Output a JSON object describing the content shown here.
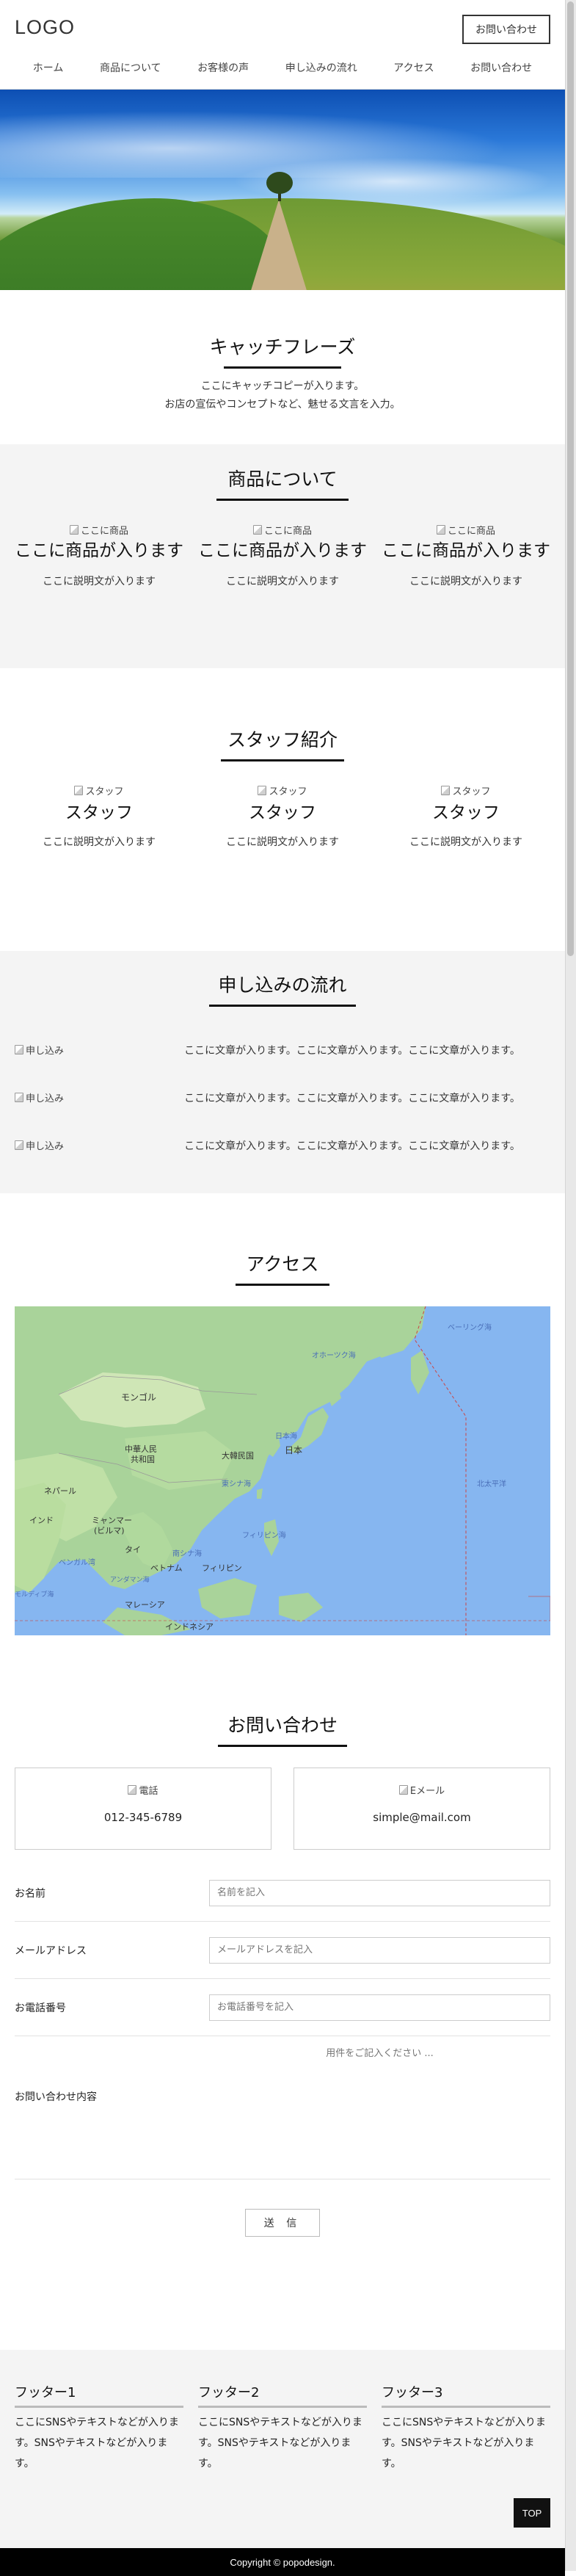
{
  "header": {
    "logo": "LOGO",
    "contact_button": "お問い合わせ",
    "nav": [
      "ホーム",
      "商品について",
      "お客様の声",
      "申し込みの流れ",
      "アクセス",
      "お問い合わせ"
    ]
  },
  "catch": {
    "title": "キャッチフレーズ",
    "line1": "ここにキャッチコピーが入ります。",
    "line2": "お店の宣伝やコンセプトなど、魅せる文言を入力。"
  },
  "products": {
    "title": "商品について",
    "items": [
      {
        "img_alt": "ここに商品",
        "name": "ここに商品が入ります",
        "desc": "ここに説明文が入ります"
      },
      {
        "img_alt": "ここに商品",
        "name": "ここに商品が入ります",
        "desc": "ここに説明文が入ります"
      },
      {
        "img_alt": "ここに商品",
        "name": "ここに商品が入ります",
        "desc": "ここに説明文が入ります"
      }
    ]
  },
  "staff": {
    "title": "スタッフ紹介",
    "items": [
      {
        "img_alt": "スタッフ",
        "name": "スタッフ",
        "desc": "ここに説明文が入ります"
      },
      {
        "img_alt": "スタッフ",
        "name": "スタッフ",
        "desc": "ここに説明文が入ります"
      },
      {
        "img_alt": "スタッフ",
        "name": "スタッフ",
        "desc": "ここに説明文が入ります"
      }
    ]
  },
  "flow": {
    "title": "申し込みの流れ",
    "items": [
      {
        "img_alt": "申し込み",
        "text": "ここに文章が入ります。ここに文章が入ります。ここに文章が入ります。"
      },
      {
        "img_alt": "申し込み",
        "text": "ここに文章が入ります。ここに文章が入ります。ここに文章が入ります。"
      },
      {
        "img_alt": "申し込み",
        "text": "ここに文章が入ります。ここに文章が入ります。ここに文章が入ります。"
      }
    ]
  },
  "access": {
    "title": "アクセス",
    "map_labels": {
      "bering": "ベーリング海",
      "okhotsk": "オホーツク海",
      "mongolia": "モンゴル",
      "china1": "中華人民",
      "china2": "共和国",
      "japan_sea": "日本海",
      "korea": "大韓民国",
      "japan": "日本",
      "east_china_sea": "東シナ海",
      "pacific": "北太平洋",
      "nepal": "ネパール",
      "india": "インド",
      "myanmar1": "ミャンマー",
      "myanmar2": "(ビルマ)",
      "philippine_sea": "フィリピン海",
      "thai": "タイ",
      "bengal": "ベンガル湾",
      "south_china_sea": "南シナ海",
      "vietnam": "ベトナム",
      "philippines": "フィリピン",
      "andaman": "アンダマン海",
      "maldives": "モルディブ海",
      "malaysia": "マレーシア",
      "indonesia": "インドネシア"
    }
  },
  "contact": {
    "title": "お問い合わせ",
    "phone_alt": "電話",
    "phone": "012-345-6789",
    "mail_alt": "Eメール",
    "mail": "simple@mail.com",
    "name_label": "お名前",
    "name_placeholder": "名前を記入",
    "email_label": "メールアドレス",
    "email_placeholder": "メールアドレスを記入",
    "tel_label": "お電話番号",
    "tel_placeholder": "お電話番号を記入",
    "message_label": "お問い合わせ内容",
    "message_placeholder": "用件をご記入ください ...",
    "submit": "送 信"
  },
  "footer": {
    "cols": [
      {
        "title": "フッター1",
        "text": "ここにSNSやテキストなどが入ります。SNSやテキストなどが入ります。"
      },
      {
        "title": "フッター2",
        "text": "ここにSNSやテキストなどが入ります。SNSやテキストなどが入ります。"
      },
      {
        "title": "フッター3",
        "text": "ここにSNSやテキストなどが入ります。SNSやテキストなどが入ります。"
      }
    ],
    "top_button": "TOP",
    "copyright": "Copyright © popodesign."
  }
}
